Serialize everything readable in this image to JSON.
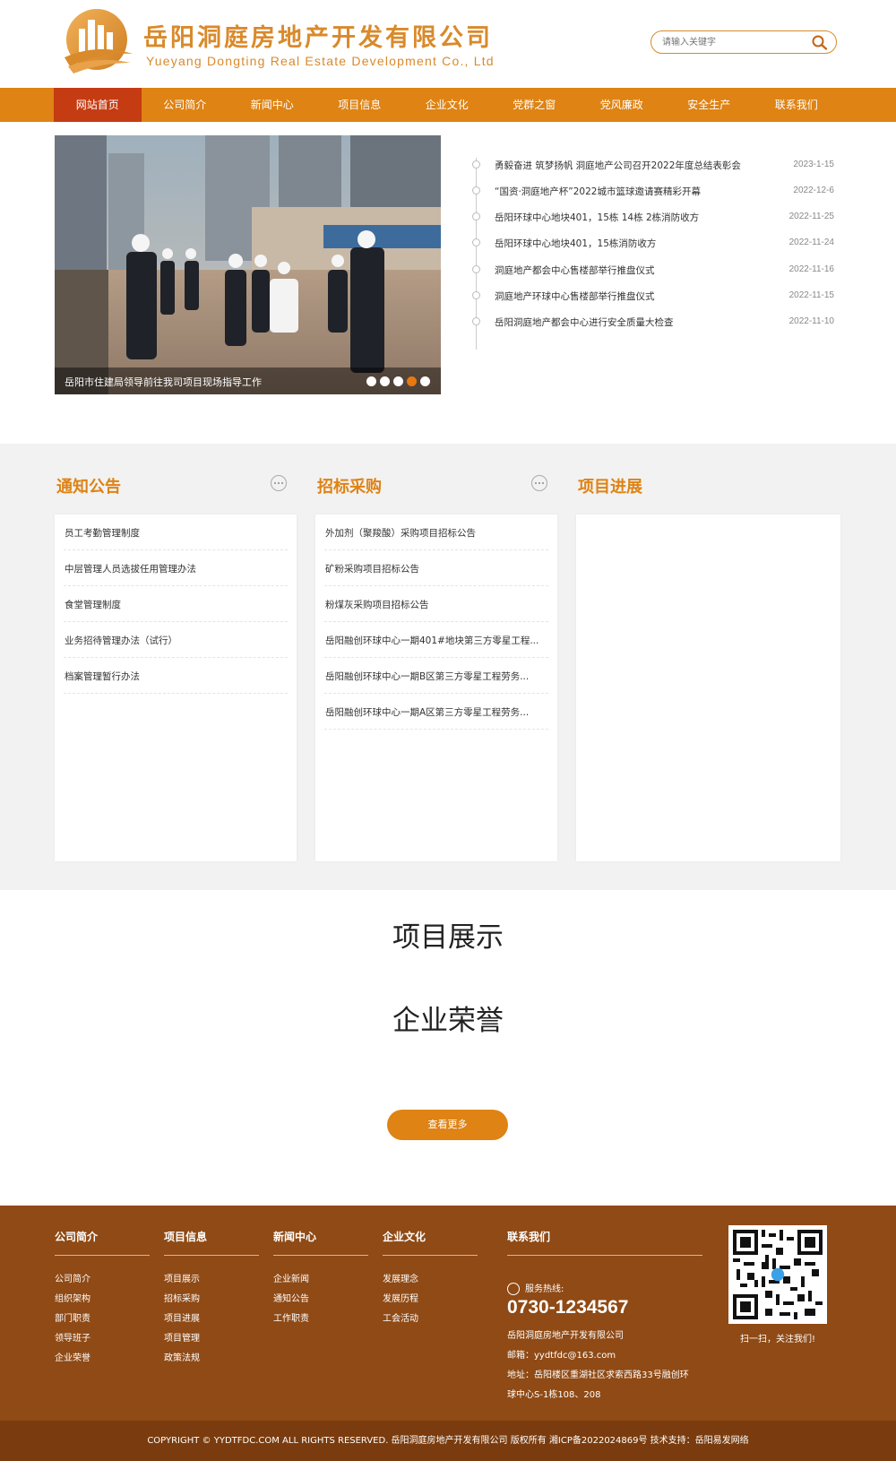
{
  "brand": {
    "name_cn": "岳阳洞庭房地产开发有限公司",
    "name_en": "Yueyang Dongting Real Estate Development Co., Ltd",
    "accent": "#de8314",
    "active_nav": "#c53b12",
    "footer_bg": "#8f4a15"
  },
  "search": {
    "placeholder": "请输入关键字",
    "icon": "search-icon"
  },
  "nav": [
    "网站首页",
    "公司简介",
    "新闻中心",
    "项目信息",
    "企业文化",
    "党群之窗",
    "党风廉政",
    "安全生产",
    "联系我们"
  ],
  "hero": {
    "caption": "岳阳市住建局领导前往我司项目现场指导工作",
    "slides": 5,
    "active_slide": 4
  },
  "news": [
    {
      "title": "勇毅奋进 筑梦扬帆 洞庭地产公司召开2022年度总结表彰会",
      "date": "2023-1-15"
    },
    {
      "title": "“国资·洞庭地产杯”2022城市篮球邀请赛精彩开幕",
      "date": "2022-12-6"
    },
    {
      "title": "岳阳环球中心地块401，15栋 14栋 2栋消防收方",
      "date": "2022-11-25"
    },
    {
      "title": "岳阳环球中心地块401，15栋消防收方",
      "date": "2022-11-24"
    },
    {
      "title": "洞庭地产都会中心售楼部举行推盘仪式",
      "date": "2022-11-16"
    },
    {
      "title": "洞庭地产环球中心售楼部举行推盘仪式",
      "date": "2022-11-15"
    },
    {
      "title": "岳阳洞庭地产都会中心进行安全质量大检查",
      "date": "2022-11-10"
    }
  ],
  "notices": {
    "title": "通知公告",
    "items": [
      "员工考勤管理制度",
      "中层管理人员选拔任用管理办法",
      "食堂管理制度",
      "业务招待管理办法（试行）",
      "档案管理暂行办法"
    ]
  },
  "bidding": {
    "title": "招标采购",
    "items": [
      "外加剂（聚羧酸）采购项目招标公告",
      "矿粉采购项目招标公告",
      "粉煤灰采购项目招标公告",
      "岳阳融创环球中心一期401#地块第三方零星工程...",
      "岳阳融创环球中心一期B区第三方零星工程劳务...",
      "岳阳融创环球中心一期A区第三方零星工程劳务..."
    ]
  },
  "progress": {
    "title": "项目进展"
  },
  "showcase": {
    "projects_title": "项目展示",
    "honors_title": "企业荣誉",
    "more_label": "查看更多"
  },
  "footer": {
    "columns": [
      {
        "title": "公司简介",
        "links": [
          "公司简介",
          "组织架构",
          "部门职责",
          "领导班子",
          "企业荣誉"
        ]
      },
      {
        "title": "项目信息",
        "links": [
          "项目展示",
          "招标采购",
          "项目进展",
          "项目管理",
          "政策法规"
        ]
      },
      {
        "title": "新闻中心",
        "links": [
          "企业新闻",
          "通知公告",
          "工作职责"
        ]
      },
      {
        "title": "企业文化",
        "links": [
          "发展理念",
          "发展历程",
          "工会活动"
        ]
      }
    ],
    "contact": {
      "title": "联系我们",
      "hotline_label": "服务热线:",
      "phone": "0730-1234567",
      "company": "岳阳洞庭房地产开发有限公司",
      "email": "邮箱：yydtfdc@163.com",
      "address_1": "地址：岳阳楼区重湖社区求索西路33号融创环",
      "address_2": "球中心S-1栋108、208"
    },
    "qr_caption": "扫一扫，关注我们!",
    "copyright": "COPYRIGHT © YYDTFDC.COM ALL RIGHTS RESERVED. 岳阳洞庭房地产开发有限公司 版权所有    湘ICP备2022024869号    技术支持：岳阳易发网络"
  }
}
